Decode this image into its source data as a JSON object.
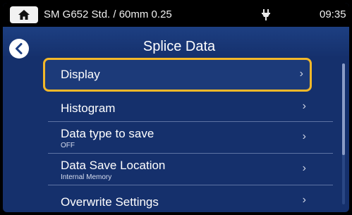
{
  "status": {
    "title": "SM G652 Std. / 60mm 0.25",
    "time": "09:35",
    "home_icon": "home-icon",
    "power_icon": "plug-icon"
  },
  "header": {
    "title": "Splice Data",
    "back_icon": "chevron-left-icon"
  },
  "colors": {
    "background": "#15306c",
    "highlight": "#f3b829"
  },
  "menu": {
    "selected_index": 0,
    "items": [
      {
        "label": "Display",
        "sub": ""
      },
      {
        "label": "Histogram",
        "sub": ""
      },
      {
        "label": "Data type to save",
        "sub": "OFF"
      },
      {
        "label": "Data Save Location",
        "sub": "Internal Memory"
      },
      {
        "label": "Overwrite Settings",
        "sub": ""
      }
    ]
  }
}
